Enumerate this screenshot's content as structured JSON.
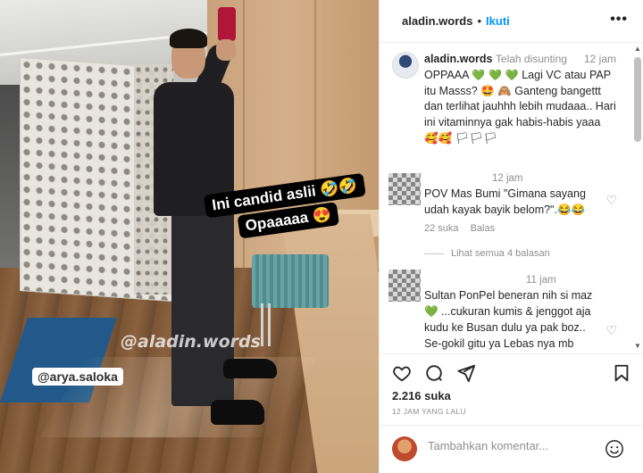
{
  "photo": {
    "story_line1": "Ini candid aslii 🤣🤣",
    "story_line2": "Opaaaaa 😍",
    "watermark": "@aladin.words",
    "mention": "@arya.saloka"
  },
  "header": {
    "username": "aladin.words",
    "separator": "•",
    "follow_label": "Ikuti",
    "more_label": "•••"
  },
  "caption": {
    "username": "aladin.words",
    "edited": "Telah disunting",
    "time": "12 jam",
    "text_part1": "OPPAAA",
    "hearts": "💚 💚 💚",
    "text_part2": "Lagi VC atau PAP itu Masss? 🤩 🙈 Ganteng bangettt dan terlihat jauhhh lebih mudaaa.. Hari ini vitaminnya gak habis-habis yaaa 🥰🥰 🏳🏳🏳"
  },
  "comments": [
    {
      "time": "12 jam",
      "text": "POV Mas Bumi \"Gimana sayang udah kayak bayik belom?\".😂😂",
      "likes": "22 suka",
      "reply": "Balas",
      "view_replies": "Lihat semua 4 balasan"
    },
    {
      "time": "11 jam",
      "text": "Sultan PonPel beneran nih si maz 💚 ...cukuran kumis & jenggot aja kudu ke Busan dulu ya pak boz.. Se-gokil gitu ya Lebas nya mb Bulan... Pingin minta referensi nama"
    }
  ],
  "post": {
    "likes": "2.216 suka",
    "time_ago": "12 JAM YANG LALU",
    "icons": [
      "heart-icon",
      "comment-icon",
      "share-icon",
      "bookmark-icon"
    ]
  },
  "comment_box": {
    "placeholder": "Tambahkan komentar...",
    "emoji_icon": "smiley-icon"
  },
  "colors": {
    "accent": "#0095f6",
    "muted": "#8e8e8e",
    "text": "#262626"
  }
}
